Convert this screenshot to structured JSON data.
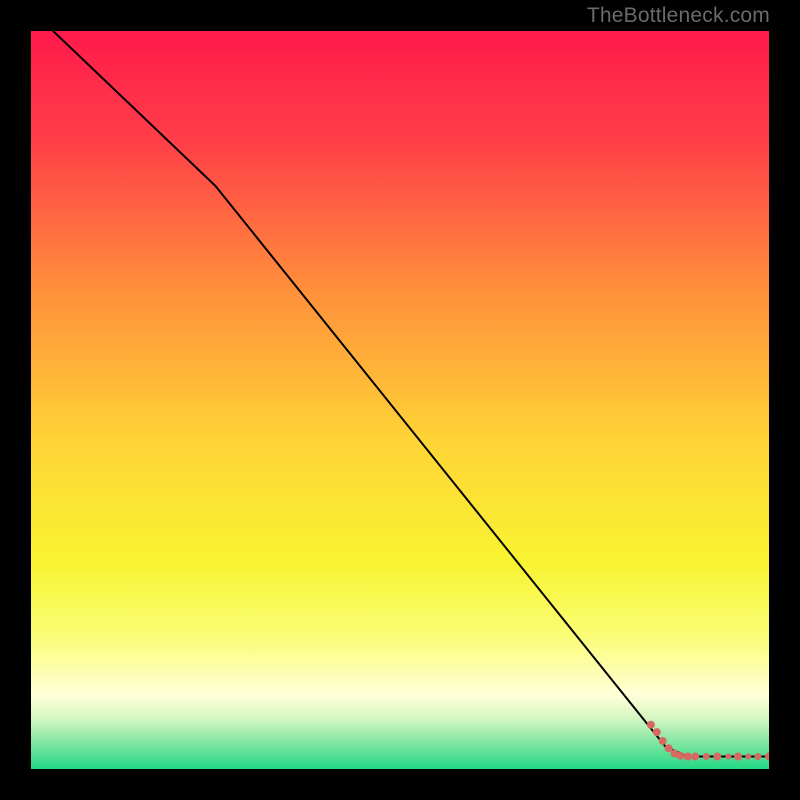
{
  "watermark": "TheBottleneck.com",
  "chart_data": {
    "type": "line",
    "title": "",
    "xlabel": "",
    "ylabel": "",
    "xlim": [
      0,
      100
    ],
    "ylim": [
      0,
      100
    ],
    "grid": false,
    "legend": false,
    "background_gradient": {
      "stops": [
        {
          "offset": 0.0,
          "color": "#ff1a4b"
        },
        {
          "offset": 0.15,
          "color": "#ff3f48"
        },
        {
          "offset": 0.35,
          "color": "#ff8f3b"
        },
        {
          "offset": 0.55,
          "color": "#ffd236"
        },
        {
          "offset": 0.72,
          "color": "#f8f431"
        },
        {
          "offset": 0.82,
          "color": "#fafd76"
        },
        {
          "offset": 0.9,
          "color": "#ffffd9"
        },
        {
          "offset": 0.93,
          "color": "#d8f7c4"
        },
        {
          "offset": 0.96,
          "color": "#8de8a6"
        },
        {
          "offset": 1.0,
          "color": "#23d885"
        }
      ]
    },
    "series": [
      {
        "name": "curve",
        "type": "line",
        "color": "#000000",
        "width": 2,
        "points": [
          {
            "x": 3,
            "y": 100
          },
          {
            "x": 25,
            "y": 79
          },
          {
            "x": 86,
            "y": 3
          },
          {
            "x": 89,
            "y": 1.7
          },
          {
            "x": 100,
            "y": 1.7
          }
        ]
      },
      {
        "name": "marker-band",
        "type": "scatter",
        "color": "#d66a63",
        "points": [
          {
            "x": 84.0,
            "y": 6.0,
            "r": 4.0
          },
          {
            "x": 84.8,
            "y": 5.0,
            "r": 4.0
          },
          {
            "x": 85.6,
            "y": 3.8,
            "r": 4.0
          },
          {
            "x": 86.4,
            "y": 2.8,
            "r": 4.0
          },
          {
            "x": 87.2,
            "y": 2.1,
            "r": 4.0
          },
          {
            "x": 88.0,
            "y": 1.8,
            "r": 4.0
          },
          {
            "x": 89.0,
            "y": 1.7,
            "r": 4.0
          },
          {
            "x": 90.0,
            "y": 1.7,
            "r": 4.0
          },
          {
            "x": 91.5,
            "y": 1.7,
            "r": 3.5
          },
          {
            "x": 93.0,
            "y": 1.7,
            "r": 4.0
          },
          {
            "x": 94.5,
            "y": 1.7,
            "r": 3.0
          },
          {
            "x": 95.8,
            "y": 1.7,
            "r": 4.0
          },
          {
            "x": 97.2,
            "y": 1.7,
            "r": 3.0
          },
          {
            "x": 98.5,
            "y": 1.7,
            "r": 3.5
          },
          {
            "x": 100.0,
            "y": 1.7,
            "r": 4.0
          }
        ]
      }
    ]
  }
}
